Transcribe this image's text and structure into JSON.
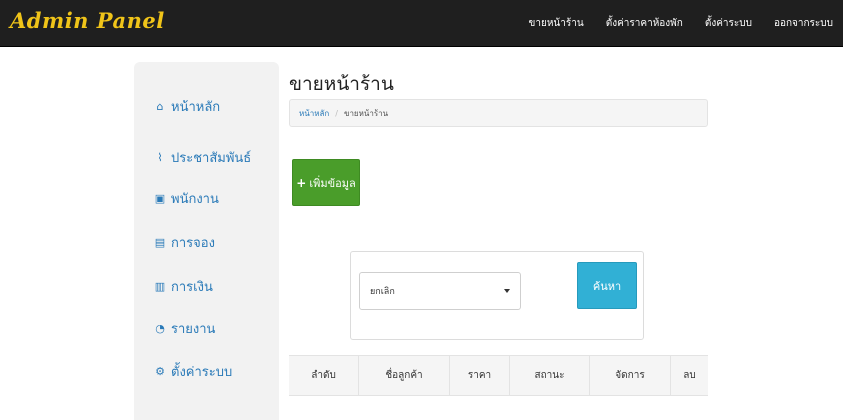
{
  "navbar": {
    "brand": "Admin Panel",
    "links": [
      "ขายหน้าร้าน",
      "ตั้งค่าราคาห้องพัก",
      "ตั้งค่าระบบ",
      "ออกจากระบบ"
    ]
  },
  "sidebar": {
    "items": [
      {
        "label": "หน้าหลัก",
        "icon": "home-icon",
        "glyph": "⌂"
      },
      {
        "label": "ประชาสัมพันธ์",
        "icon": "rss-icon",
        "glyph": "⌇"
      },
      {
        "label": "พนักงาน",
        "icon": "id-card-icon",
        "glyph": "▣"
      },
      {
        "label": "การจอง",
        "icon": "calendar-icon",
        "glyph": "▤"
      },
      {
        "label": "การเงิน",
        "icon": "document-icon",
        "glyph": "▥"
      },
      {
        "label": "รายงาน",
        "icon": "chart-icon",
        "glyph": "◔"
      },
      {
        "label": "ตั้งค่าระบบ",
        "icon": "gear-icon",
        "glyph": "⚙"
      }
    ]
  },
  "main": {
    "title": "ขายหน้าร้าน",
    "breadcrumb": {
      "home": "หน้าหลัก",
      "separator": "/",
      "current": "ขายหน้าร้าน"
    },
    "add_button": {
      "plus": "+",
      "label": "เพิ่มข้อมูล"
    },
    "search": {
      "select_value": "ยกเลิก",
      "button_label": "ค้นหา"
    },
    "table": {
      "headers": [
        "ลำดับ",
        "ชื่อลูกค้า",
        "ราคา",
        "สถานะ",
        "จัดการ",
        "ลบ"
      ]
    }
  },
  "colors": {
    "navbar": "#1f1f1f",
    "brand": "#f0c419",
    "link": "#2a7ab8",
    "add_button": "#4a9d2a",
    "search_button": "#31b0d5"
  }
}
